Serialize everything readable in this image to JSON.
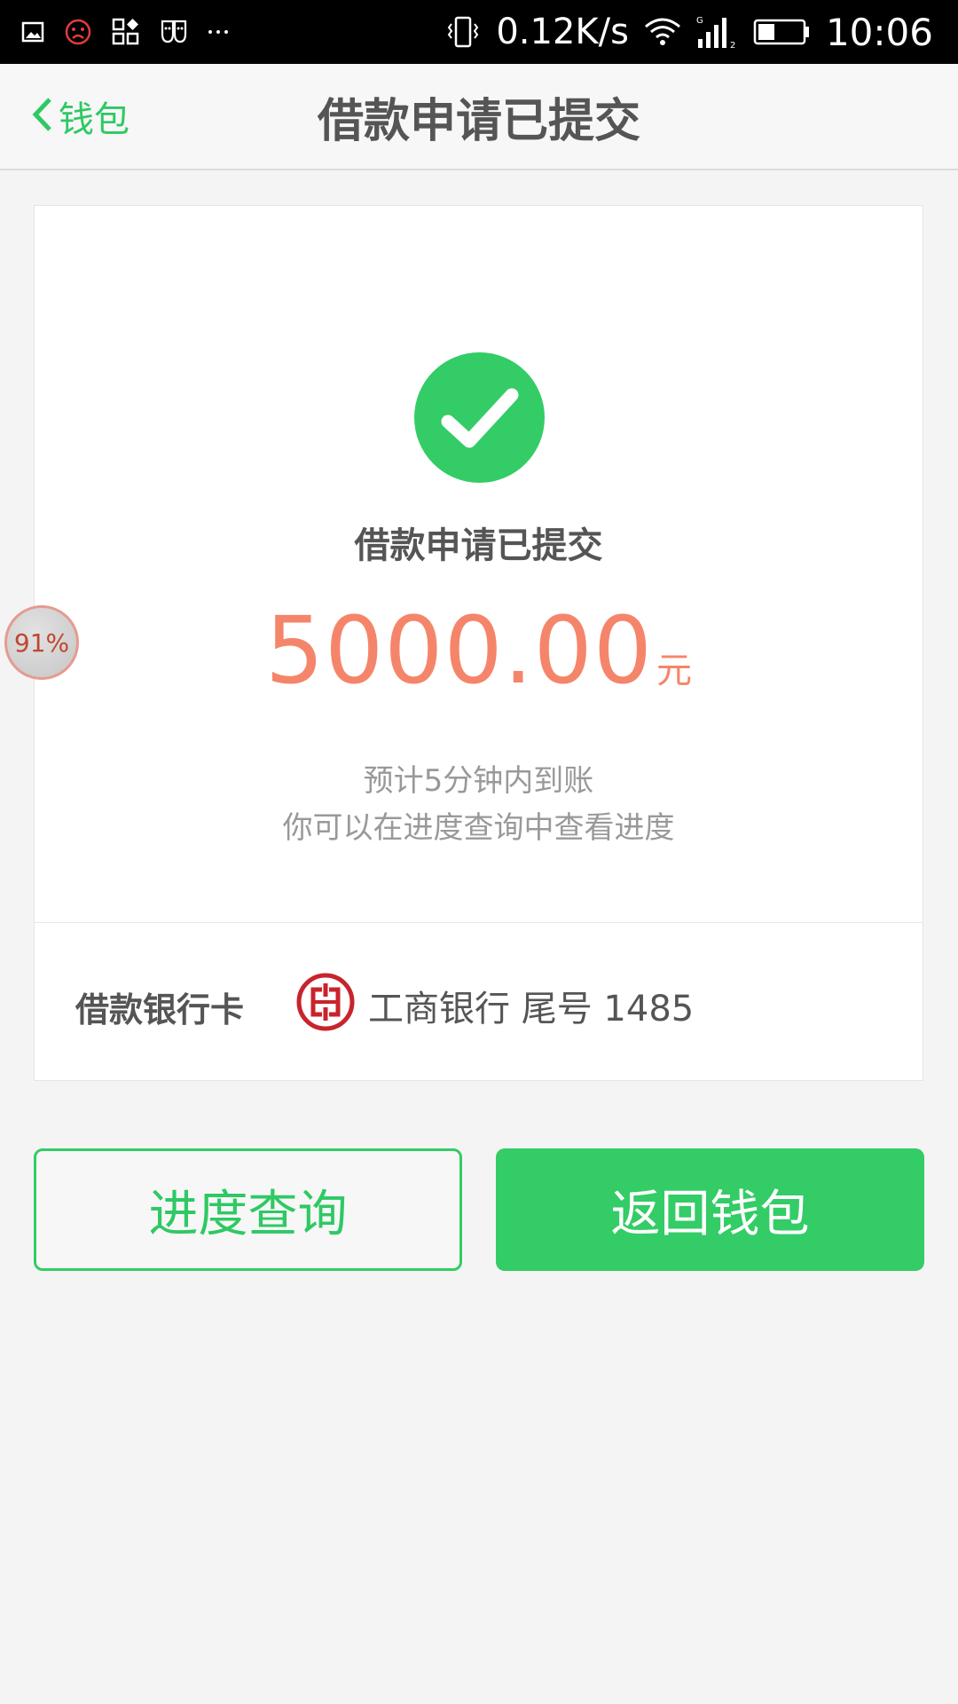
{
  "status_bar": {
    "net_speed": "0.12K/s",
    "time": "10:06",
    "icons_left": [
      "image-icon",
      "sad-face-icon",
      "apps-icon",
      "masks-icon",
      "more-icon"
    ],
    "icons_right": [
      "vibrate-icon",
      "wifi-icon",
      "signal-icon",
      "battery-icon"
    ]
  },
  "header": {
    "back_label": "钱包",
    "title": "借款申请已提交"
  },
  "result": {
    "heading": "借款申请已提交",
    "amount": "5000.00",
    "unit": "元",
    "note_line1": "预计5分钟内到账",
    "note_line2": "你可以在进度查询中查看进度"
  },
  "bank": {
    "label": "借款银行卡",
    "card_text": "工商银行 尾号 1485"
  },
  "buttons": {
    "progress_label": "进度查询",
    "return_label": "返回钱包"
  },
  "floating_bubble": {
    "text": "91%"
  },
  "colors": {
    "accent_green": "#33cc66",
    "amount_orange": "#f5856a",
    "bank_red": "#c8242c"
  }
}
